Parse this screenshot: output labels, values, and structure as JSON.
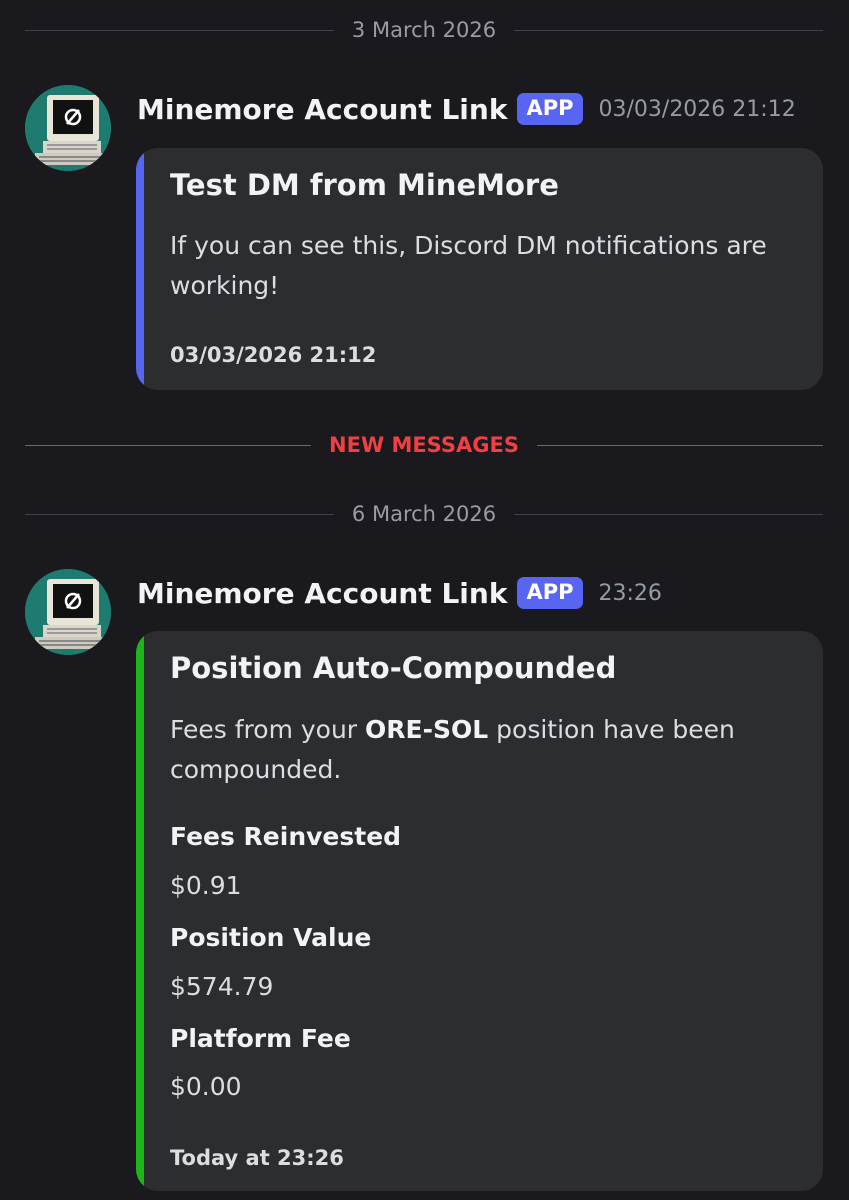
{
  "dividers": {
    "date1": "3 March 2026",
    "new_messages": "NEW MESSAGES",
    "date2": "6 March 2026"
  },
  "colors": {
    "background": "#1a1a1e",
    "embed_bg": "#2b2d31",
    "accent_blurple": "#5865f2",
    "accent_green": "#1db517",
    "new_messages_red": "#f23f43"
  },
  "messages": [
    {
      "author": "Minemore Account Link",
      "badge": "APP",
      "timestamp": "03/03/2026 21:12",
      "avatar_icon": "retro-computer-icon",
      "embed": {
        "accent": "#5865f2",
        "title": "Test DM from MineMore",
        "description": "If you can see this, Discord DM notifications are working!",
        "footer": "03/03/2026 21:12"
      }
    },
    {
      "author": "Minemore Account Link",
      "badge": "APP",
      "timestamp": "23:26",
      "avatar_icon": "retro-computer-icon",
      "embed": {
        "accent": "#1db517",
        "title": "Position Auto-Compounded",
        "description_pre": "Fees from your ",
        "description_bold": "ORE-SOL",
        "description_post": " position have been compounded.",
        "fields": [
          {
            "name": "Fees Reinvested",
            "value": "$0.91"
          },
          {
            "name": "Position Value",
            "value": "$574.79"
          },
          {
            "name": "Platform Fee",
            "value": "$0.00"
          }
        ],
        "footer": "Today at 23:26"
      }
    }
  ]
}
